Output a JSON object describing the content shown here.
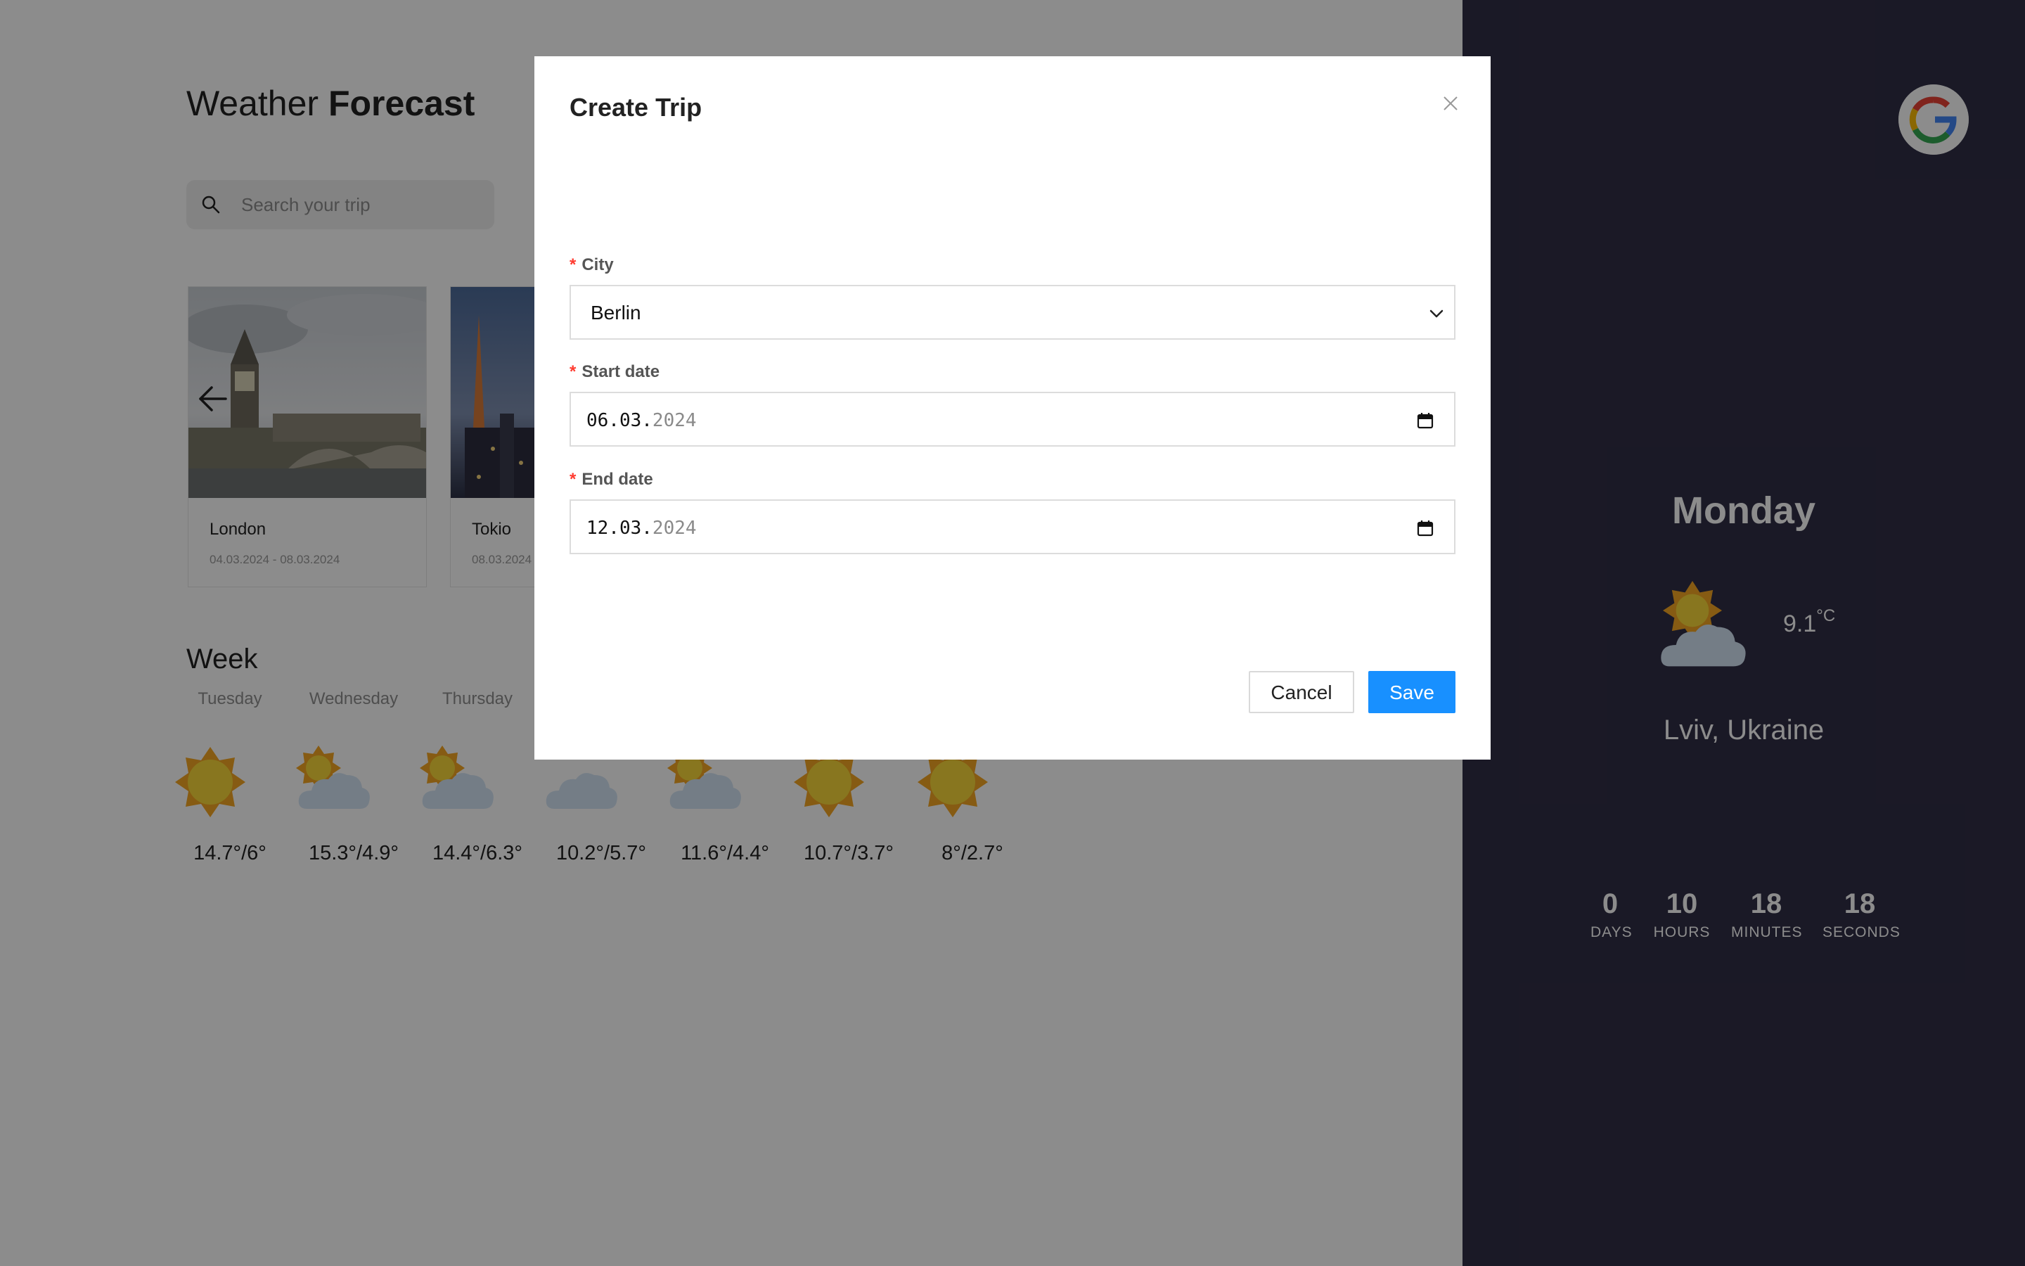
{
  "header": {
    "title_light": "Weather",
    "title_bold": "Forecast"
  },
  "search": {
    "placeholder": "Search your trip"
  },
  "trips": [
    {
      "city": "London",
      "dates": "04.03.2024 - 08.03.2024"
    },
    {
      "city": "Tokio",
      "dates": "08.03.2024"
    }
  ],
  "week": {
    "title": "Week",
    "days": [
      {
        "name": "Tuesday",
        "icon": "sun-icon",
        "temp": "14.7°/6°"
      },
      {
        "name": "Wednesday",
        "icon": "partly-cloudy-icon",
        "temp": "15.3°/4.9°"
      },
      {
        "name": "Thursday",
        "icon": "partly-cloudy-icon",
        "temp": "14.4°/6.3°"
      },
      {
        "name": "",
        "icon": "cloud-icon",
        "temp": "10.2°/5.7°"
      },
      {
        "name": "",
        "icon": "partly-cloudy-icon",
        "temp": "11.6°/4.4°"
      },
      {
        "name": "",
        "icon": "sun-icon",
        "temp": "10.7°/3.7°"
      },
      {
        "name": "",
        "icon": "sun-icon",
        "temp": "8°/2.7°"
      }
    ]
  },
  "today": {
    "day": "Monday",
    "icon": "partly-cloudy-icon",
    "temp": "9.1",
    "unit": "°C",
    "location": "Lviv, Ukraine"
  },
  "countdown": [
    {
      "value": "0",
      "label": "DAYS"
    },
    {
      "value": "10",
      "label": "HOURS"
    },
    {
      "value": "18",
      "label": "MINUTES"
    },
    {
      "value": "18",
      "label": "SECONDS"
    }
  ],
  "modal": {
    "title": "Create Trip",
    "required_mark": "*",
    "city_label": "City",
    "city_value": "Berlin",
    "start_label": "Start date",
    "start_value_day_month": "06.03.",
    "start_value_year": "2024",
    "end_label": "End date",
    "end_value_day_month": "12.03.",
    "end_value_year": "2024",
    "cancel_label": "Cancel",
    "save_label": "Save"
  },
  "colors": {
    "side_panel": "#312e46",
    "primary_button": "#1890ff",
    "required": "#ff3b30",
    "overlay": "rgba(0,0,0,0.45)"
  }
}
